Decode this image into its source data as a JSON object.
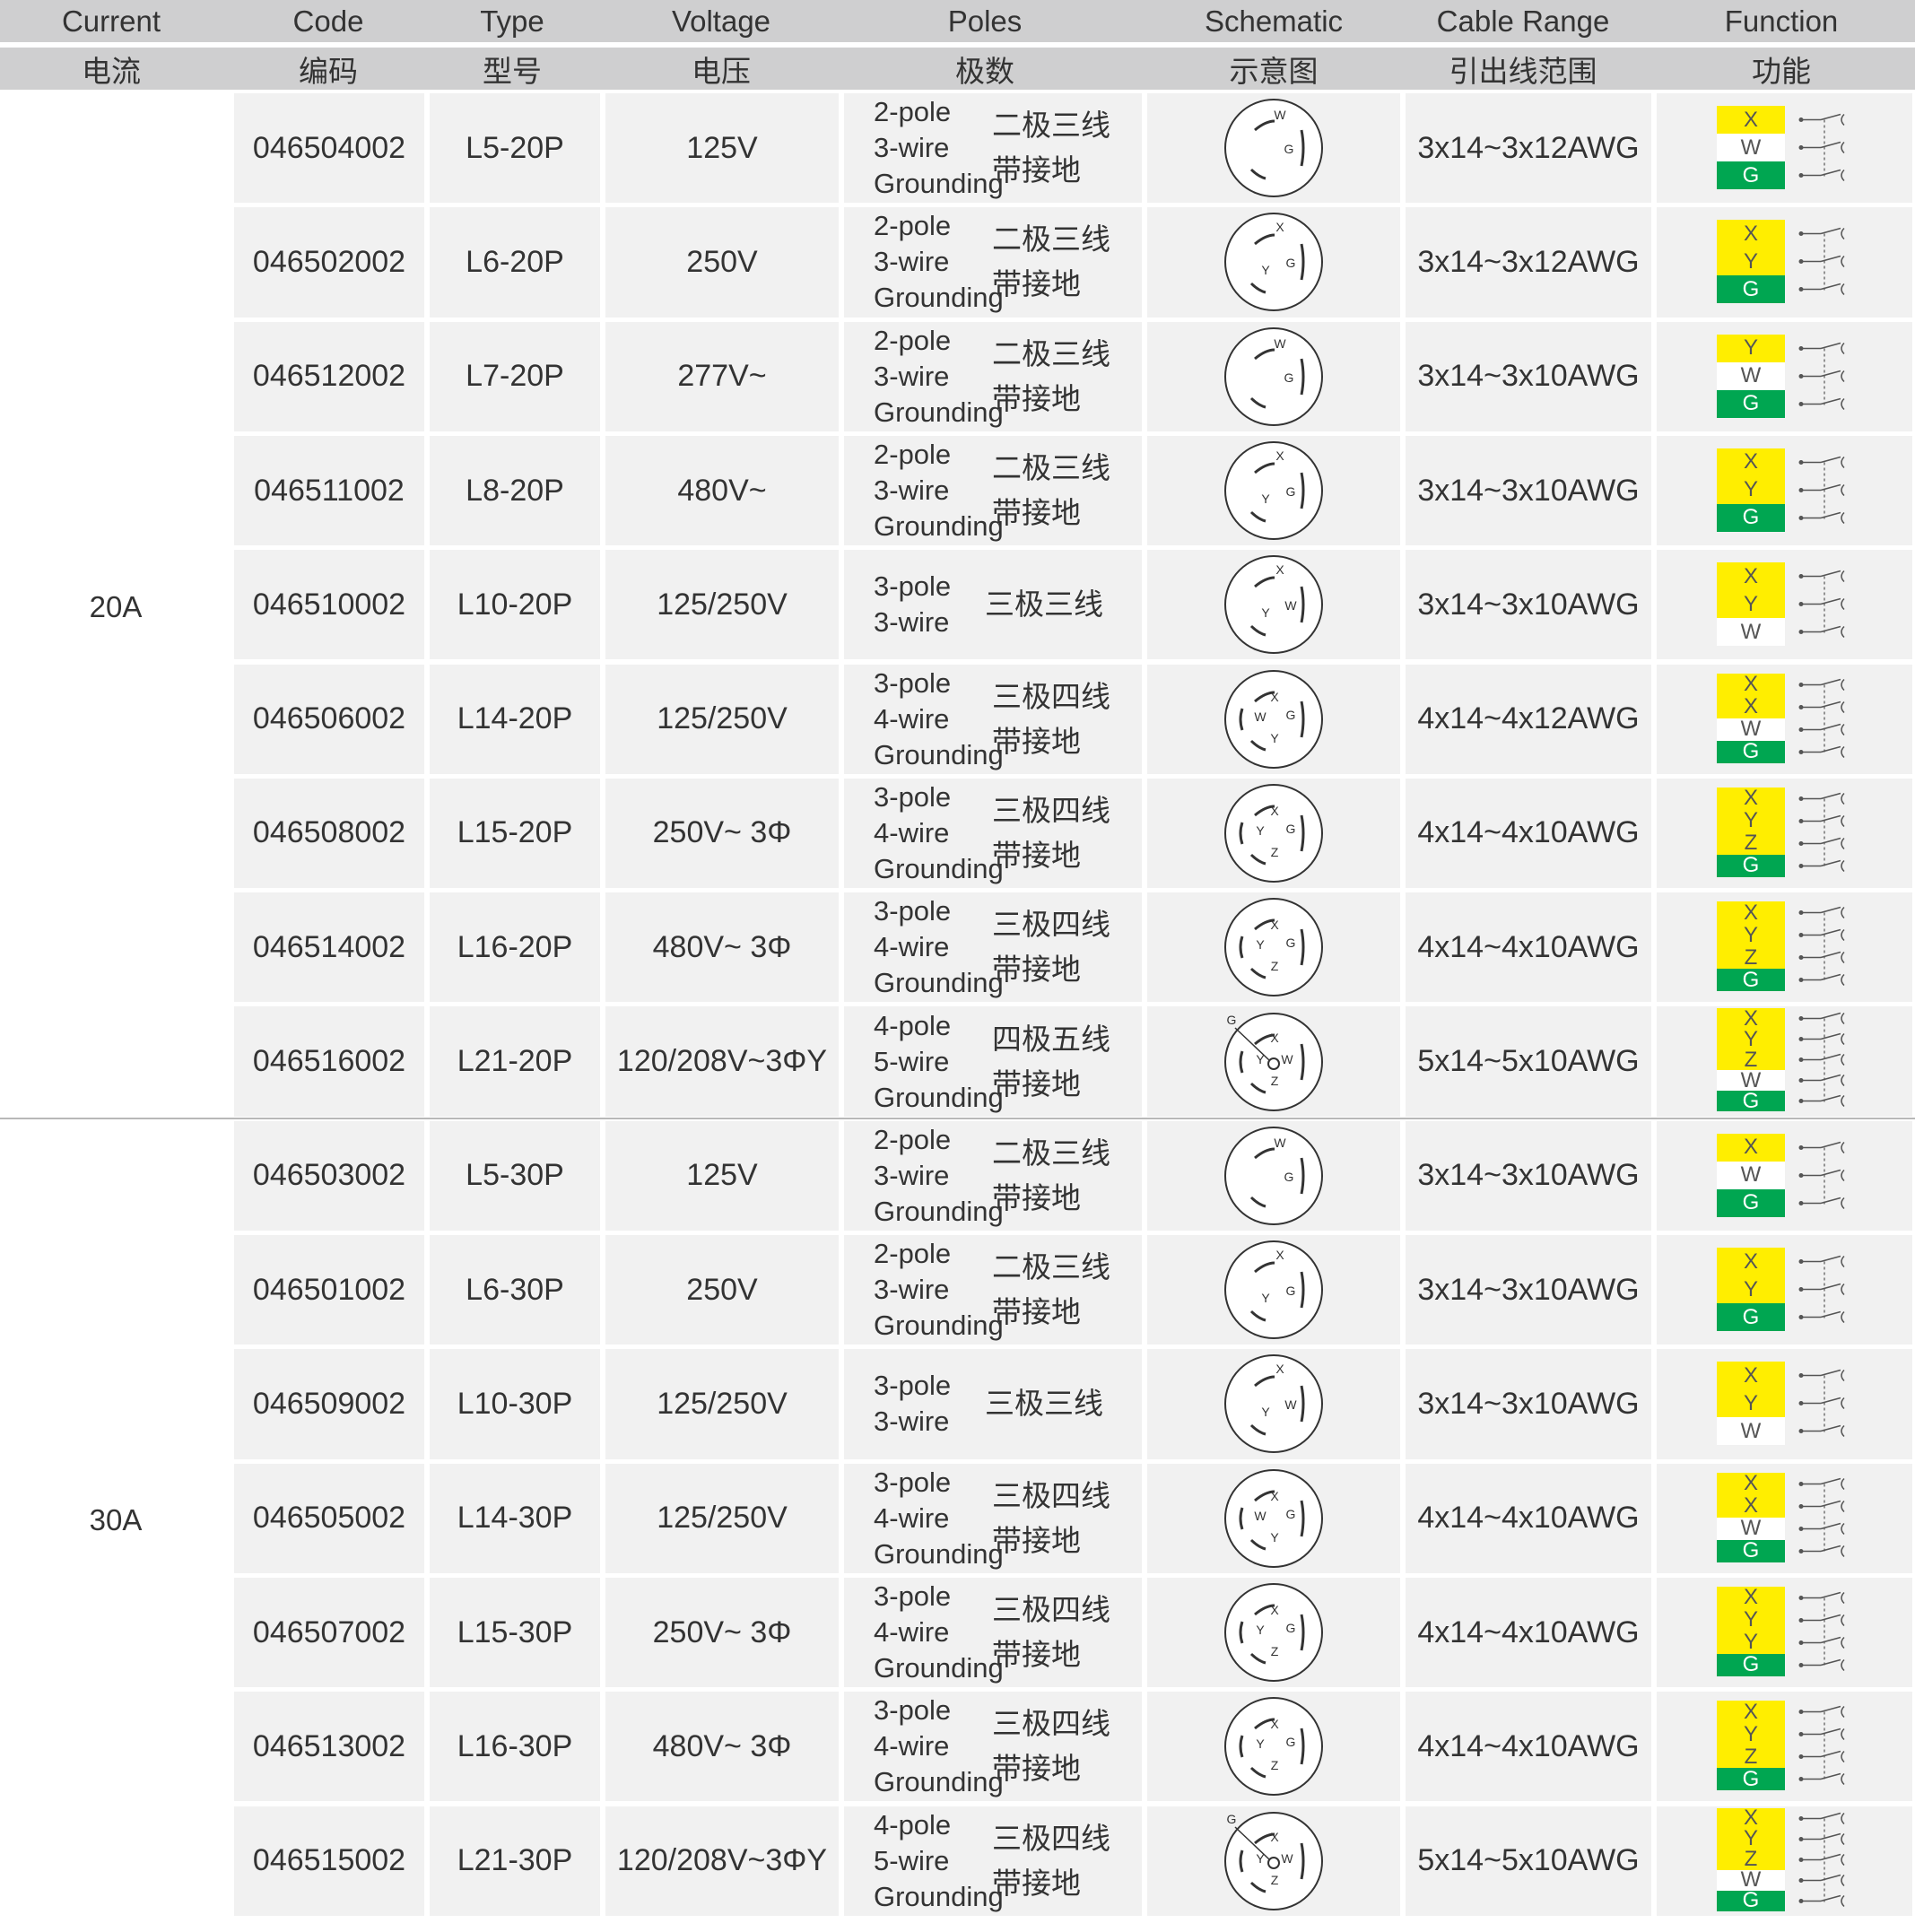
{
  "colors": {
    "header_bg": "#cfcfd0",
    "row_bg": "#f1f1f1",
    "yellow": "#ffee00",
    "green": "#00a651",
    "white": "#ffffff"
  },
  "header": {
    "en": [
      "Current",
      "Code",
      "Type",
      "Voltage",
      "Poles",
      "Schematic",
      "Cable Range",
      "Function"
    ],
    "zh": [
      "电流",
      "编码",
      "型号",
      "电压",
      "极数",
      "示意图",
      "引出线范围",
      "功能"
    ]
  },
  "groups": [
    {
      "current": "20A",
      "rows": [
        {
          "code": "046504002",
          "type": "L5-20P",
          "voltage": "125V",
          "poles_en": [
            "2-pole",
            "3-wire",
            "Grounding"
          ],
          "poles_zh": [
            "二极三线",
            "带接地"
          ],
          "cable": "3x14~3x12AWG",
          "schematic_icon": "l5-20-plug-icon",
          "schematic_labels": [
            "W",
            "G"
          ],
          "wires": [
            "X",
            "W",
            "G"
          ]
        },
        {
          "code": "046502002",
          "type": "L6-20P",
          "voltage": "250V",
          "poles_en": [
            "2-pole",
            "3-wire",
            "Grounding"
          ],
          "poles_zh": [
            "二极三线",
            "带接地"
          ],
          "cable": "3x14~3x12AWG",
          "schematic_icon": "l6-20-plug-icon",
          "schematic_labels": [
            "X",
            "Y",
            "G"
          ],
          "wires": [
            "X",
            "Y",
            "G"
          ]
        },
        {
          "code": "046512002",
          "type": "L7-20P",
          "voltage": "277V~",
          "poles_en": [
            "2-pole",
            "3-wire",
            "Grounding"
          ],
          "poles_zh": [
            "二极三线",
            "带接地"
          ],
          "cable": "3x14~3x10AWG",
          "schematic_icon": "l7-20-plug-icon",
          "schematic_labels": [
            "W",
            "G"
          ],
          "wires": [
            "Y",
            "W",
            "G"
          ]
        },
        {
          "code": "046511002",
          "type": "L8-20P",
          "voltage": "480V~",
          "poles_en": [
            "2-pole",
            "3-wire",
            "Grounding"
          ],
          "poles_zh": [
            "二极三线",
            "带接地"
          ],
          "cable": "3x14~3x10AWG",
          "schematic_icon": "l8-20-plug-icon",
          "schematic_labels": [
            "X",
            "Y",
            "G"
          ],
          "wires": [
            "X",
            "Y",
            "G"
          ]
        },
        {
          "code": "046510002",
          "type": "L10-20P",
          "voltage": "125/250V",
          "poles_en": [
            "3-pole",
            "3-wire"
          ],
          "poles_zh": [
            "三极三线"
          ],
          "cable": "3x14~3x10AWG",
          "schematic_icon": "l10-20-plug-icon",
          "schematic_labels": [
            "X",
            "Y",
            "W"
          ],
          "wires": [
            "X",
            "Y",
            "W"
          ]
        },
        {
          "code": "046506002",
          "type": "L14-20P",
          "voltage": "125/250V",
          "poles_en": [
            "3-pole",
            "4-wire",
            "Grounding"
          ],
          "poles_zh": [
            "三极四线",
            "带接地"
          ],
          "cable": "4x14~4x12AWG",
          "schematic_icon": "l14-20-plug-icon",
          "schematic_labels": [
            "X",
            "W",
            "G",
            "Y"
          ],
          "wires": [
            "X",
            "X",
            "W",
            "G"
          ]
        },
        {
          "code": "046508002",
          "type": "L15-20P",
          "voltage": "250V~ 3Φ",
          "poles_en": [
            "3-pole",
            "4-wire",
            "Grounding"
          ],
          "poles_zh": [
            "三极四线",
            "带接地"
          ],
          "cable": "4x14~4x10AWG",
          "schematic_icon": "l15-20-plug-icon",
          "schematic_labels": [
            "X",
            "Y",
            "G",
            "Z"
          ],
          "wires": [
            "X",
            "Y",
            "Z",
            "G"
          ]
        },
        {
          "code": "046514002",
          "type": "L16-20P",
          "voltage": "480V~ 3Φ",
          "poles_en": [
            "3-pole",
            "4-wire",
            "Grounding"
          ],
          "poles_zh": [
            "三极四线",
            "带接地"
          ],
          "cable": "4x14~4x10AWG",
          "schematic_icon": "l16-20-plug-icon",
          "schematic_labels": [
            "X",
            "Y",
            "G",
            "Z"
          ],
          "wires": [
            "X",
            "Y",
            "Z",
            "G"
          ]
        },
        {
          "code": "046516002",
          "type": "L21-20P",
          "voltage": "120/208V~3ΦY",
          "poles_en": [
            "4-pole",
            "5-wire",
            "Grounding"
          ],
          "poles_zh": [
            "四极五线",
            "带接地"
          ],
          "cable": "5x14~5x10AWG",
          "schematic_icon": "l21-20-plug-icon",
          "schematic_labels": [
            "G",
            "X",
            "Y",
            "W",
            "Z"
          ],
          "wires": [
            "X",
            "Y",
            "Z",
            "W",
            "G"
          ]
        }
      ]
    },
    {
      "current": "30A",
      "rows": [
        {
          "code": "046503002",
          "type": "L5-30P",
          "voltage": "125V",
          "poles_en": [
            "2-pole",
            "3-wire",
            "Grounding"
          ],
          "poles_zh": [
            "二极三线",
            "带接地"
          ],
          "cable": "3x14~3x10AWG",
          "schematic_icon": "l5-30-plug-icon",
          "schematic_labels": [
            "W",
            "G"
          ],
          "wires": [
            "X",
            "W",
            "G"
          ]
        },
        {
          "code": "046501002",
          "type": "L6-30P",
          "voltage": "250V",
          "poles_en": [
            "2-pole",
            "3-wire",
            "Grounding"
          ],
          "poles_zh": [
            "二极三线",
            "带接地"
          ],
          "cable": "3x14~3x10AWG",
          "schematic_icon": "l6-30-plug-icon",
          "schematic_labels": [
            "X",
            "Y",
            "G"
          ],
          "wires": [
            "X",
            "Y",
            "G"
          ]
        },
        {
          "code": "046509002",
          "type": "L10-30P",
          "voltage": "125/250V",
          "poles_en": [
            "3-pole",
            "3-wire"
          ],
          "poles_zh": [
            "三极三线"
          ],
          "cable": "3x14~3x10AWG",
          "schematic_icon": "l10-30-plug-icon",
          "schematic_labels": [
            "X",
            "Y",
            "W"
          ],
          "wires": [
            "X",
            "Y",
            "W"
          ]
        },
        {
          "code": "046505002",
          "type": "L14-30P",
          "voltage": "125/250V",
          "poles_en": [
            "3-pole",
            "4-wire",
            "Grounding"
          ],
          "poles_zh": [
            "三极四线",
            "带接地"
          ],
          "cable": "4x14~4x10AWG",
          "schematic_icon": "l14-30-plug-icon",
          "schematic_labels": [
            "X",
            "W",
            "G",
            "Y"
          ],
          "wires": [
            "X",
            "X",
            "W",
            "G"
          ]
        },
        {
          "code": "046507002",
          "type": "L15-30P",
          "voltage": "250V~ 3Φ",
          "poles_en": [
            "3-pole",
            "4-wire",
            "Grounding"
          ],
          "poles_zh": [
            "三极四线",
            "带接地"
          ],
          "cable": "4x14~4x10AWG",
          "schematic_icon": "l15-30-plug-icon",
          "schematic_labels": [
            "X",
            "Y",
            "G",
            "Z"
          ],
          "wires": [
            "X",
            "Y",
            "Y",
            "G"
          ]
        },
        {
          "code": "046513002",
          "type": "L16-30P",
          "voltage": "480V~ 3Φ",
          "poles_en": [
            "3-pole",
            "4-wire",
            "Grounding"
          ],
          "poles_zh": [
            "三极四线",
            "带接地"
          ],
          "cable": "4x14~4x10AWG",
          "schematic_icon": "l16-30-plug-icon",
          "schematic_labels": [
            "X",
            "Y",
            "G",
            "Z"
          ],
          "wires": [
            "X",
            "Y",
            "Z",
            "G"
          ]
        },
        {
          "code": "046515002",
          "type": "L21-30P",
          "voltage": "120/208V~3ΦY",
          "poles_en": [
            "4-pole",
            "5-wire",
            "Grounding"
          ],
          "poles_zh": [
            "三极四线",
            "带接地"
          ],
          "cable": "5x14~5x10AWG",
          "schematic_icon": "l21-30-plug-icon",
          "schematic_labels": [
            "G",
            "X",
            "Y",
            "W",
            "Z"
          ],
          "wires": [
            "X",
            "Y",
            "Z",
            "W",
            "G"
          ]
        }
      ]
    }
  ]
}
